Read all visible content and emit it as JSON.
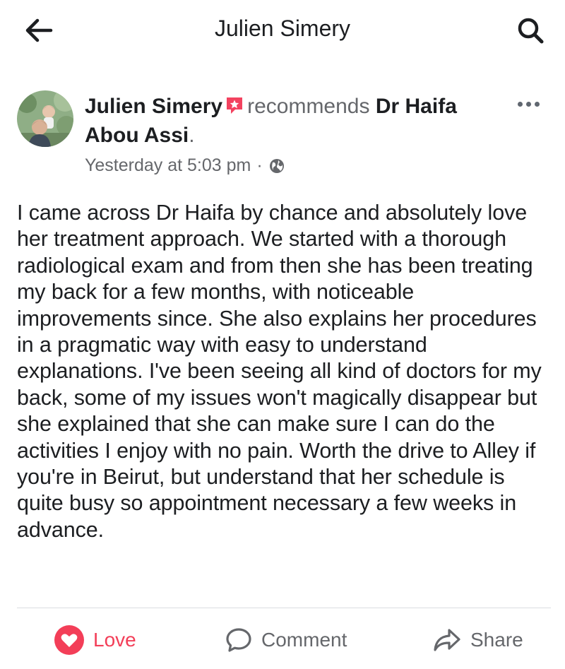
{
  "topbar": {
    "title": "Julien Simery",
    "back_icon": "arrow-left-icon",
    "search_icon": "search-icon"
  },
  "post": {
    "author": "Julien Simery",
    "recommend_badge_icon": "recommendation-star-icon",
    "recommends_text": "recommends",
    "page_name": "Dr Haifa Abou Assi",
    "page_name_suffix": ".",
    "timestamp": "Yesterday at 5:03 pm",
    "separator": "·",
    "privacy_icon": "globe-icon",
    "more_icon": "more-options-icon",
    "body": "I came across Dr Haifa by chance and absolutely love her treatment approach. We started with a thorough radiological exam and from then she has been treating my back for a few months, with noticeable improvements since. She also explains her procedures in a pragmatic way with easy to understand explanations. I've been seeing all kind of doctors for my back, some of my issues won't magically disappear but she explained that she can make sure I can do the activities I enjoy with no pain. Worth the drive to Alley if you're in Beirut, but understand that her schedule is quite busy so appointment necessary a few weeks in advance."
  },
  "actions": {
    "love_label": "Love",
    "comment_label": "Comment",
    "share_label": "Share"
  },
  "colors": {
    "love": "#f33e58",
    "secondary_text": "#65676b",
    "recommend_badge": "#f3425f",
    "divider": "#dadde1"
  }
}
